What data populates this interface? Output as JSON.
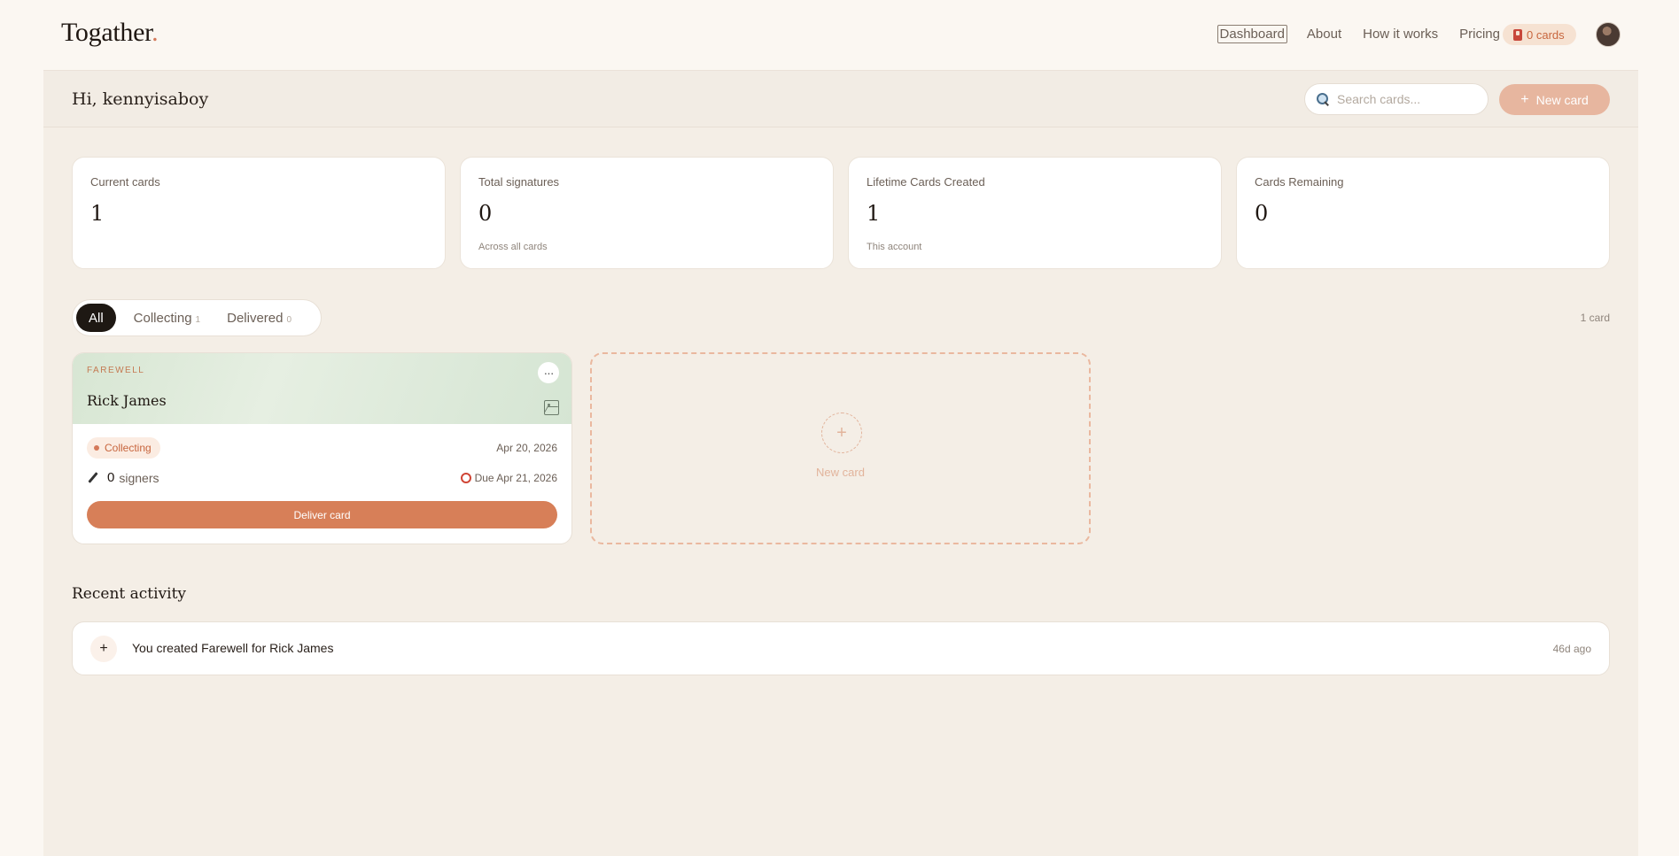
{
  "brand": {
    "name": "Togather",
    "dot": "."
  },
  "nav": {
    "links": [
      "Dashboard",
      "About",
      "How it works",
      "Pricing"
    ],
    "cards_pill": "0 cards"
  },
  "header": {
    "greeting": "Hi, kennyisaboy",
    "search_placeholder": "Search cards...",
    "new_card_label": "New card"
  },
  "stats": [
    {
      "label": "Current cards",
      "value": "1",
      "sub": ""
    },
    {
      "label": "Total signatures",
      "value": "0",
      "sub": "Across all cards"
    },
    {
      "label": "Lifetime Cards Created",
      "value": "1",
      "sub": "This account"
    },
    {
      "label": "Cards Remaining",
      "value": "0",
      "sub": ""
    }
  ],
  "filters": {
    "all": "All",
    "collecting": {
      "label": "Collecting",
      "count": "1"
    },
    "delivered": {
      "label": "Delivered",
      "count": "0"
    },
    "card_count": "1 card"
  },
  "card": {
    "category": "FAREWELL",
    "title": "Rick James",
    "status": "Collecting",
    "date": "Apr 20, 2026",
    "signers_count": "0",
    "signers_label": "signers",
    "due": "Due Apr 21, 2026",
    "deliver_label": "Deliver card",
    "more": "···"
  },
  "new_card_placeholder": {
    "label": "New card",
    "plus": "+"
  },
  "recent": {
    "title": "Recent activity",
    "items": [
      {
        "icon": "+",
        "text": "You created Farewell for Rick James",
        "time": "46d ago"
      }
    ]
  },
  "colors": {
    "accent": "#d77f58",
    "background": "#fbf7f2",
    "panel": "#f4eee6"
  }
}
